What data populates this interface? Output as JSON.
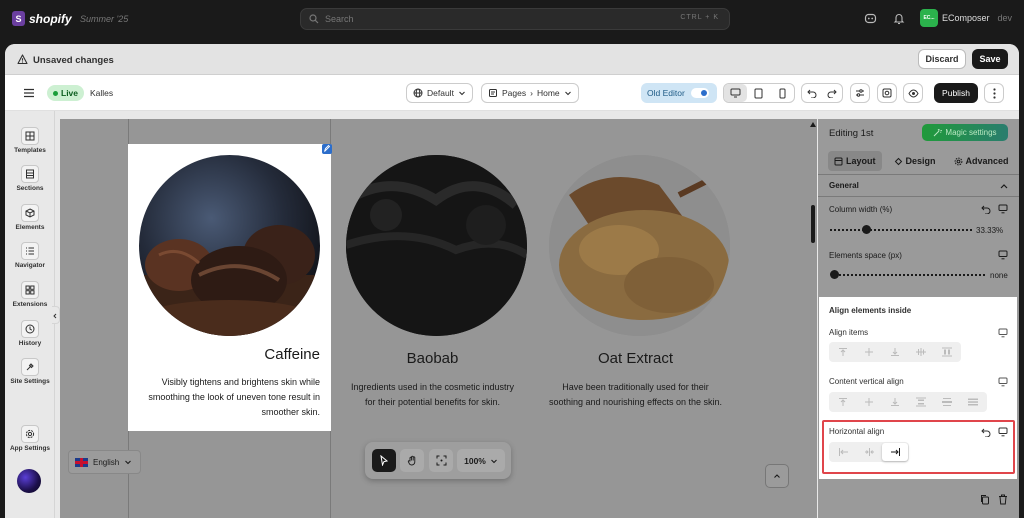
{
  "topbar": {
    "brand": "shopify",
    "edition": "Summer '25",
    "search_placeholder": "Search",
    "search_shortcut": "CTRL + K",
    "account_initials": "EC...",
    "account_name": "EComposer",
    "account_suffix": "dev"
  },
  "unsaved_bar": {
    "message": "Unsaved changes",
    "discard": "Discard",
    "save": "Save"
  },
  "toolbar": {
    "status": "Live",
    "store_name": "Kalles",
    "template_select": "Default",
    "breadcrumb_root": "Pages",
    "breadcrumb_page": "Home",
    "old_editor": "Old Editor",
    "publish": "Publish"
  },
  "left_sidebar": {
    "items": [
      {
        "label": "Templates",
        "icon": "templates-icon"
      },
      {
        "label": "Sections",
        "icon": "sections-icon"
      },
      {
        "label": "Elements",
        "icon": "elements-icon"
      },
      {
        "label": "Navigator",
        "icon": "navigator-icon"
      },
      {
        "label": "Extensions",
        "icon": "extensions-icon"
      },
      {
        "label": "History",
        "icon": "history-icon"
      },
      {
        "label": "Site Settings",
        "icon": "site-settings-icon"
      },
      {
        "label": "App Settings",
        "icon": "app-settings-icon"
      }
    ]
  },
  "canvas": {
    "columns": [
      {
        "title": "Caffeine",
        "text": "Visibly tightens and brightens skin while smoothing the look of uneven tone result in smoother skin."
      },
      {
        "title": "Baobab",
        "text": "Ingredients used in the cosmetic industry for their potential benefits for skin."
      },
      {
        "title": "Oat Extract",
        "text": "Have been traditionally used for their soothing and nourishing effects on the skin."
      }
    ],
    "language": "English",
    "zoom": "100%"
  },
  "right_panel": {
    "editing": "Editing 1st",
    "magic_settings": "Magic settings",
    "tabs": [
      "Layout",
      "Design",
      "Advanced"
    ],
    "section_general": "General",
    "column_width_label": "Column width (%)",
    "column_width_value": "33.33%",
    "column_width_fraction": 0.25,
    "elements_space_label": "Elements space (px)",
    "elements_space_value": "none",
    "align_heading": "Align elements inside",
    "align_items_label": "Align items",
    "content_vertical_label": "Content vertical align",
    "horizontal_align_label": "Horizontal align"
  },
  "colors": {
    "accent_green": "#1f9a3a",
    "highlight_red": "#e0454b",
    "live_badge": "#cdf0d2",
    "old_editor_bg": "#cfe5f5"
  }
}
